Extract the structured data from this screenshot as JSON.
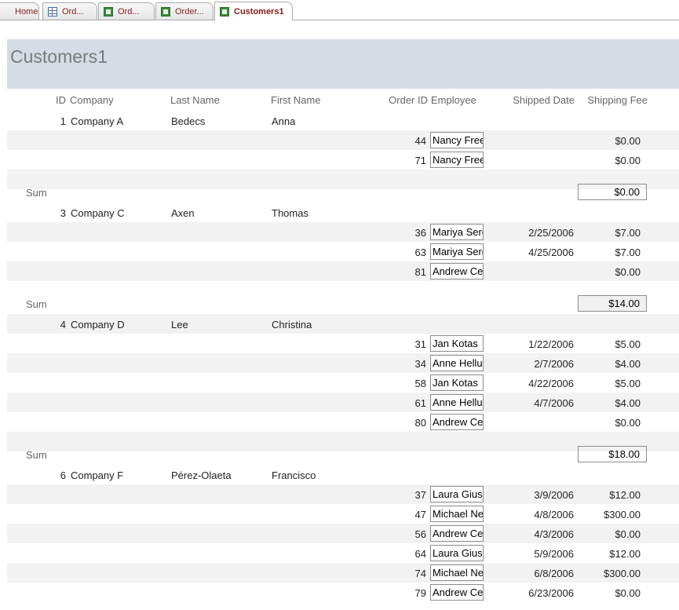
{
  "tabs": [
    {
      "label": "Home",
      "icon": "home-icon"
    },
    {
      "label": "Ord...",
      "icon": "table-icon"
    },
    {
      "label": "Ord...",
      "icon": "report-icon"
    },
    {
      "label": "Order...",
      "icon": "report-icon"
    },
    {
      "label": "Customers1",
      "icon": "report-icon",
      "active": true
    }
  ],
  "report": {
    "title": "Customers1",
    "headers": {
      "id": "ID",
      "company": "Company",
      "last_name": "Last Name",
      "first_name": "First Name",
      "order_id": "Order ID",
      "employee": "Employee",
      "shipped_date": "Shipped Date",
      "shipping_fee": "Shipping Fee"
    },
    "sum_label": "Sum",
    "groups": [
      {
        "id": "1",
        "company": "Company A",
        "last_name": "Bedecs",
        "first_name": "Anna",
        "orders": [
          {
            "order_id": "44",
            "employee": "Nancy Freehafer",
            "shipped_date": "",
            "shipping_fee": "$0.00"
          },
          {
            "order_id": "71",
            "employee": "Nancy Freehafer",
            "shipped_date": "",
            "shipping_fee": "$0.00"
          }
        ],
        "sum": "$0.00"
      },
      {
        "id": "3",
        "company": "Company C",
        "last_name": "Axen",
        "first_name": "Thomas",
        "orders": [
          {
            "order_id": "36",
            "employee": "Mariya Sergienko",
            "shipped_date": "2/25/2006",
            "shipping_fee": "$7.00"
          },
          {
            "order_id": "63",
            "employee": "Mariya Sergienko",
            "shipped_date": "4/25/2006",
            "shipping_fee": "$7.00"
          },
          {
            "order_id": "81",
            "employee": "Andrew Cencini",
            "shipped_date": "",
            "shipping_fee": "$0.00"
          }
        ],
        "sum": "$14.00"
      },
      {
        "id": "4",
        "company": "Company D",
        "last_name": "Lee",
        "first_name": "Christina",
        "orders": [
          {
            "order_id": "31",
            "employee": "Jan Kotas",
            "shipped_date": "1/22/2006",
            "shipping_fee": "$5.00"
          },
          {
            "order_id": "34",
            "employee": "Anne Hellung-Larsen",
            "shipped_date": "2/7/2006",
            "shipping_fee": "$4.00"
          },
          {
            "order_id": "58",
            "employee": "Jan Kotas",
            "shipped_date": "4/22/2006",
            "shipping_fee": "$5.00"
          },
          {
            "order_id": "61",
            "employee": "Anne Hellung-Larsen",
            "shipped_date": "4/7/2006",
            "shipping_fee": "$4.00"
          },
          {
            "order_id": "80",
            "employee": "Andrew Cencini",
            "shipped_date": "",
            "shipping_fee": "$0.00"
          }
        ],
        "sum": "$18.00"
      },
      {
        "id": "6",
        "company": "Company F",
        "last_name": "Pérez-Olaeta",
        "first_name": "Francisco",
        "orders": [
          {
            "order_id": "37",
            "employee": "Laura Giussani",
            "shipped_date": "3/9/2006",
            "shipping_fee": "$12.00"
          },
          {
            "order_id": "47",
            "employee": "Michael Neipper",
            "shipped_date": "4/8/2006",
            "shipping_fee": "$300.00"
          },
          {
            "order_id": "56",
            "employee": "Andrew Cencini",
            "shipped_date": "4/3/2006",
            "shipping_fee": "$0.00"
          },
          {
            "order_id": "64",
            "employee": "Laura Giussani",
            "shipped_date": "5/9/2006",
            "shipping_fee": "$12.00"
          },
          {
            "order_id": "74",
            "employee": "Michael Neipper",
            "shipped_date": "6/8/2006",
            "shipping_fee": "$300.00"
          },
          {
            "order_id": "79",
            "employee": "Andrew Cencini",
            "shipped_date": "6/23/2006",
            "shipping_fee": "$0.00"
          }
        ],
        "sum": null
      }
    ]
  },
  "colors": {
    "header_band": "#d5dce6",
    "alt_row": "#f2f2f2",
    "tab_text": "#8b1a1a"
  }
}
